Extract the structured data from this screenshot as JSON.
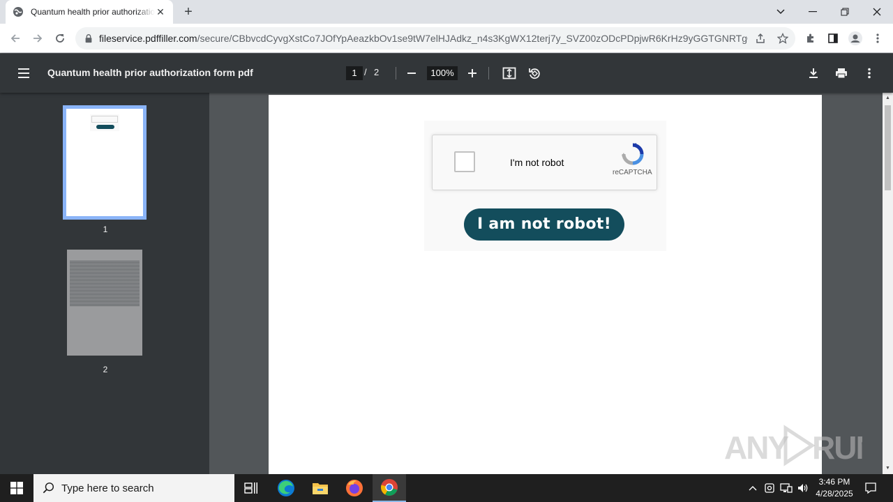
{
  "browser": {
    "tab": {
      "title": "Quantum health prior authorization form pdf",
      "close_symbol": "✕"
    },
    "new_tab_symbol": "+",
    "url_host": "fileservice.pdffiller.com",
    "url_path": "/secure/CBbvcdCyvgXstCo7JOfYpAeazkbOv1se9tW7elHJAdkz_n4s3KgWX12terj7y_SVZ00zODcPDpjwR6KrHz9yGGTGNRTgQdEN..."
  },
  "pdf_viewer": {
    "document_title": "Quantum health prior authorization form pdf",
    "current_page": "1",
    "page_separator": "/",
    "total_pages": "2",
    "zoom": "100%",
    "thumbnails": [
      {
        "label": "1",
        "selected": true
      },
      {
        "label": "2",
        "selected": false
      }
    ]
  },
  "page_content": {
    "captcha_label": "I'm not robot",
    "recaptcha_brand": "reCAPTCHA",
    "button_label": "I am not robot!",
    "button_color": "#134d5c"
  },
  "watermark": {
    "text": "ANY RUN"
  },
  "taskbar": {
    "search_placeholder": "Type here to search",
    "time": "3:46 PM",
    "date": "4/28/2025"
  },
  "colors": {
    "pdf_toolbar": "#323639",
    "viewer_bg": "#525659",
    "thumb_selected_border": "#8ab4f8"
  }
}
